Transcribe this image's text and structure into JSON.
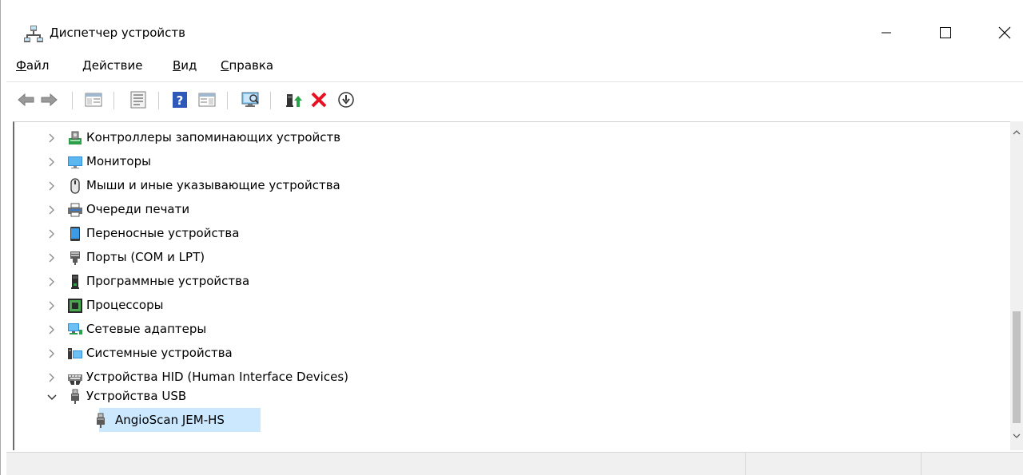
{
  "window": {
    "title": "Диспетчер устройств",
    "icon": "device-manager-icon"
  },
  "menu": {
    "items": [
      {
        "underline": "Ф",
        "rest": "айл"
      },
      {
        "underline": "Д",
        "rest": "ействие"
      },
      {
        "underline": "В",
        "rest": "ид"
      },
      {
        "underline": "С",
        "rest": "правка"
      }
    ]
  },
  "toolbar": {
    "icons": [
      "back-icon",
      "forward-icon",
      "show-hide-console-tree-icon",
      "properties-icon",
      "help-icon",
      "action-pane-icon",
      "scan-hardware-icon",
      "update-driver-icon",
      "uninstall-device-icon",
      "disable-device-icon"
    ]
  },
  "tree": {
    "items": [
      {
        "label": "Контроллеры запоминающих устройств",
        "icon": "storage-controller-icon",
        "expanded": false
      },
      {
        "label": "Мониторы",
        "icon": "monitor-icon",
        "expanded": false
      },
      {
        "label": "Мыши и иные указывающие устройства",
        "icon": "mouse-icon",
        "expanded": false
      },
      {
        "label": "Очереди печати",
        "icon": "printer-icon",
        "expanded": false
      },
      {
        "label": "Переносные устройства",
        "icon": "portable-device-icon",
        "expanded": false
      },
      {
        "label": "Порты (COM и LPT)",
        "icon": "port-icon",
        "expanded": false
      },
      {
        "label": "Программные устройства",
        "icon": "software-device-icon",
        "expanded": false
      },
      {
        "label": "Процессоры",
        "icon": "processor-icon",
        "expanded": false
      },
      {
        "label": "Сетевые адаптеры",
        "icon": "network-adapter-icon",
        "expanded": false
      },
      {
        "label": "Системные устройства",
        "icon": "system-device-icon",
        "expanded": false
      },
      {
        "label": "Устройства HID (Human Interface Devices)",
        "icon": "hid-icon",
        "expanded": false
      },
      {
        "label": "Устройства USB",
        "icon": "usb-icon",
        "expanded": true
      }
    ],
    "children": [
      {
        "label": "AngioScan JEM-HS",
        "icon": "usb-device-icon",
        "selected": true
      }
    ]
  },
  "colors": {
    "selection": "#cce8ff",
    "monitor_blue": "#2f8fd8",
    "uninstall_red": "#e81123",
    "update_green": "#2aa24a"
  }
}
